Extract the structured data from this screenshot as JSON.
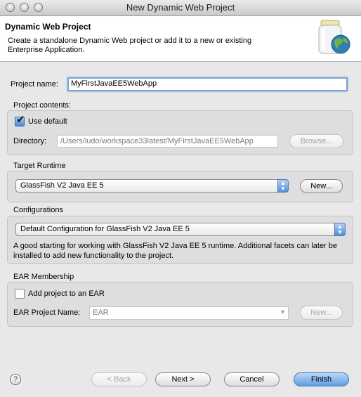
{
  "window": {
    "title": "New Dynamic Web Project"
  },
  "banner": {
    "title": "Dynamic Web Project",
    "description": "Create a standalone Dynamic Web project or add it to a new or existing Enterprise Application."
  },
  "project_name": {
    "label": "Project name:",
    "value": "MyFirstJavaEE5WebApp"
  },
  "project_contents": {
    "label": "Project contents:",
    "use_default_label": "Use default",
    "use_default_checked": true,
    "directory_label": "Directory:",
    "directory_value": "/Users/ludo/workspace33latest/MyFirstJavaEE5WebApp",
    "browse_label": "Browse..."
  },
  "target_runtime": {
    "label": "Target Runtime",
    "selected": "GlassFish V2 Java EE 5",
    "new_label": "New..."
  },
  "configurations": {
    "label": "Configurations",
    "selected": "Default Configuration for GlassFish V2 Java EE 5",
    "description": "A good starting for working with GlassFish V2 Java EE 5 runtime. Additional facets can later be installed to add new functionality to the project."
  },
  "ear": {
    "label": "EAR Membership",
    "add_label": "Add project to an EAR",
    "add_checked": false,
    "name_label": "EAR Project Name:",
    "name_value": "EAR",
    "new_label": "New..."
  },
  "footer": {
    "help": "?",
    "back": "< Back",
    "next": "Next >",
    "cancel": "Cancel",
    "finish": "Finish"
  },
  "colors": {
    "accent": "#5e9ee6",
    "focus": "#7aa7d8"
  },
  "icons": {
    "wizard_icon": "globe-jar-icon",
    "dropdown": "dropdown-arrow-icon"
  }
}
